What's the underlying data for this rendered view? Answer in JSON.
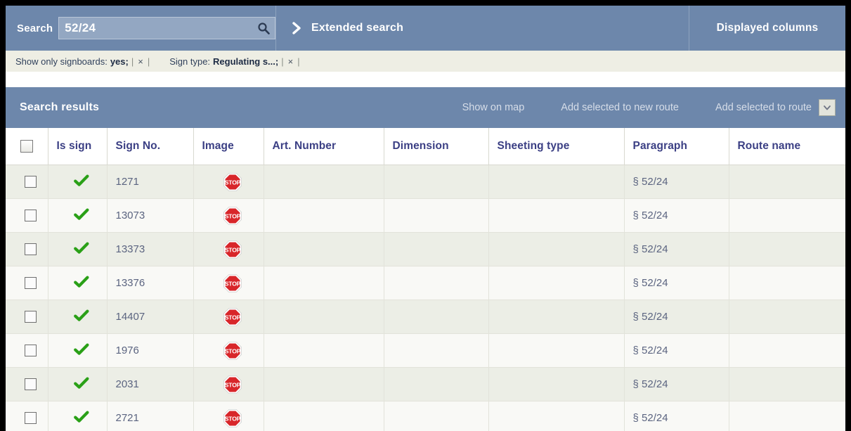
{
  "search": {
    "label": "Search",
    "value": "52/24",
    "placeholder": "",
    "magnifier_icon": "search-icon",
    "extended_label": "Extended search",
    "extended_icon": "chevron-right-icon",
    "displayed_columns_label": "Displayed columns"
  },
  "filters": [
    {
      "key": "Show only signboards:",
      "value": "yes;",
      "remove_label": "×"
    },
    {
      "key": "Sign type:",
      "value": "Regulating s...;",
      "remove_label": "×"
    }
  ],
  "results": {
    "title": "Search results",
    "actions": [
      {
        "label": "Show on map"
      },
      {
        "label": "Add selected to new route"
      },
      {
        "label": "Add selected to route"
      }
    ],
    "dropdown_icon": "chevron-down-icon"
  },
  "table": {
    "columns": [
      {
        "key": "select",
        "label": ""
      },
      {
        "key": "is_sign",
        "label": "Is sign"
      },
      {
        "key": "sign_no",
        "label": "Sign No."
      },
      {
        "key": "image",
        "label": "Image"
      },
      {
        "key": "art",
        "label": "Art. Number"
      },
      {
        "key": "dimension",
        "label": "Dimension"
      },
      {
        "key": "sheeting",
        "label": "Sheeting type"
      },
      {
        "key": "paragraph",
        "label": "Paragraph"
      },
      {
        "key": "route",
        "label": "Route name"
      }
    ],
    "header_select_all_checked": false,
    "rows": [
      {
        "selected": false,
        "is_sign": true,
        "sign_no": "1271",
        "image": "stop-sign-icon",
        "art": "",
        "dimension": "",
        "sheeting": "",
        "paragraph": "§ 52/24",
        "route": ""
      },
      {
        "selected": false,
        "is_sign": true,
        "sign_no": "13073",
        "image": "stop-sign-icon",
        "art": "",
        "dimension": "",
        "sheeting": "",
        "paragraph": "§ 52/24",
        "route": ""
      },
      {
        "selected": false,
        "is_sign": true,
        "sign_no": "13373",
        "image": "stop-sign-icon",
        "art": "",
        "dimension": "",
        "sheeting": "",
        "paragraph": "§ 52/24",
        "route": ""
      },
      {
        "selected": false,
        "is_sign": true,
        "sign_no": "13376",
        "image": "stop-sign-icon",
        "art": "",
        "dimension": "",
        "sheeting": "",
        "paragraph": "§ 52/24",
        "route": ""
      },
      {
        "selected": false,
        "is_sign": true,
        "sign_no": "14407",
        "image": "stop-sign-icon",
        "art": "",
        "dimension": "",
        "sheeting": "",
        "paragraph": "§ 52/24",
        "route": ""
      },
      {
        "selected": false,
        "is_sign": true,
        "sign_no": "1976",
        "image": "stop-sign-icon",
        "art": "",
        "dimension": "",
        "sheeting": "",
        "paragraph": "§ 52/24",
        "route": ""
      },
      {
        "selected": false,
        "is_sign": true,
        "sign_no": "2031",
        "image": "stop-sign-icon",
        "art": "",
        "dimension": "",
        "sheeting": "",
        "paragraph": "§ 52/24",
        "route": ""
      },
      {
        "selected": false,
        "is_sign": true,
        "sign_no": "2721",
        "image": "stop-sign-icon",
        "art": "",
        "dimension": "",
        "sheeting": "",
        "paragraph": "§ 52/24",
        "route": ""
      }
    ]
  },
  "sign_image": {
    "text": "STOP"
  },
  "colors": {
    "header_blue": "#6d87ab",
    "filter_bar": "#eeeee4",
    "row_odd": "#eceee6",
    "row_even": "#f9f9f6",
    "header_text": "#3b3f84",
    "cell_text": "#5b6480",
    "check_green": "#2aa017",
    "sign_red": "#d8262a"
  }
}
